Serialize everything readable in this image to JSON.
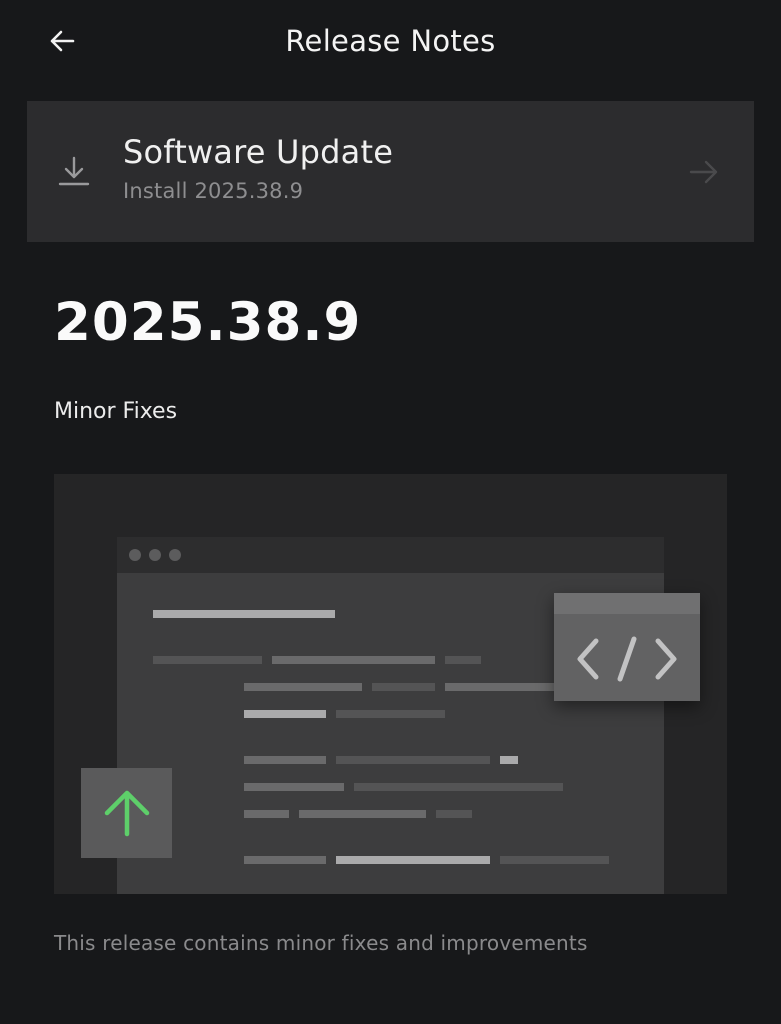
{
  "header": {
    "title": "Release Notes",
    "back_icon": "arrow-left-icon"
  },
  "update_card": {
    "title": "Software Update",
    "subtitle": "Install 2025.38.9",
    "leading_icon": "download-icon",
    "trailing_icon": "arrow-right-icon"
  },
  "release": {
    "version": "2025.38.9",
    "heading": "Minor Fixes",
    "description": "This release contains minor fixes and improvements"
  },
  "illustration": {
    "window_icon": "browser-window-icon",
    "code_icon": "code-brackets-icon",
    "upgrade_icon": "arrow-up-icon",
    "accent_color": "#5ecf6a"
  },
  "colors": {
    "background": "#17181a",
    "card": "#2c2c2e",
    "text_primary": "#f2f2f2",
    "text_secondary": "#8e8e90"
  }
}
